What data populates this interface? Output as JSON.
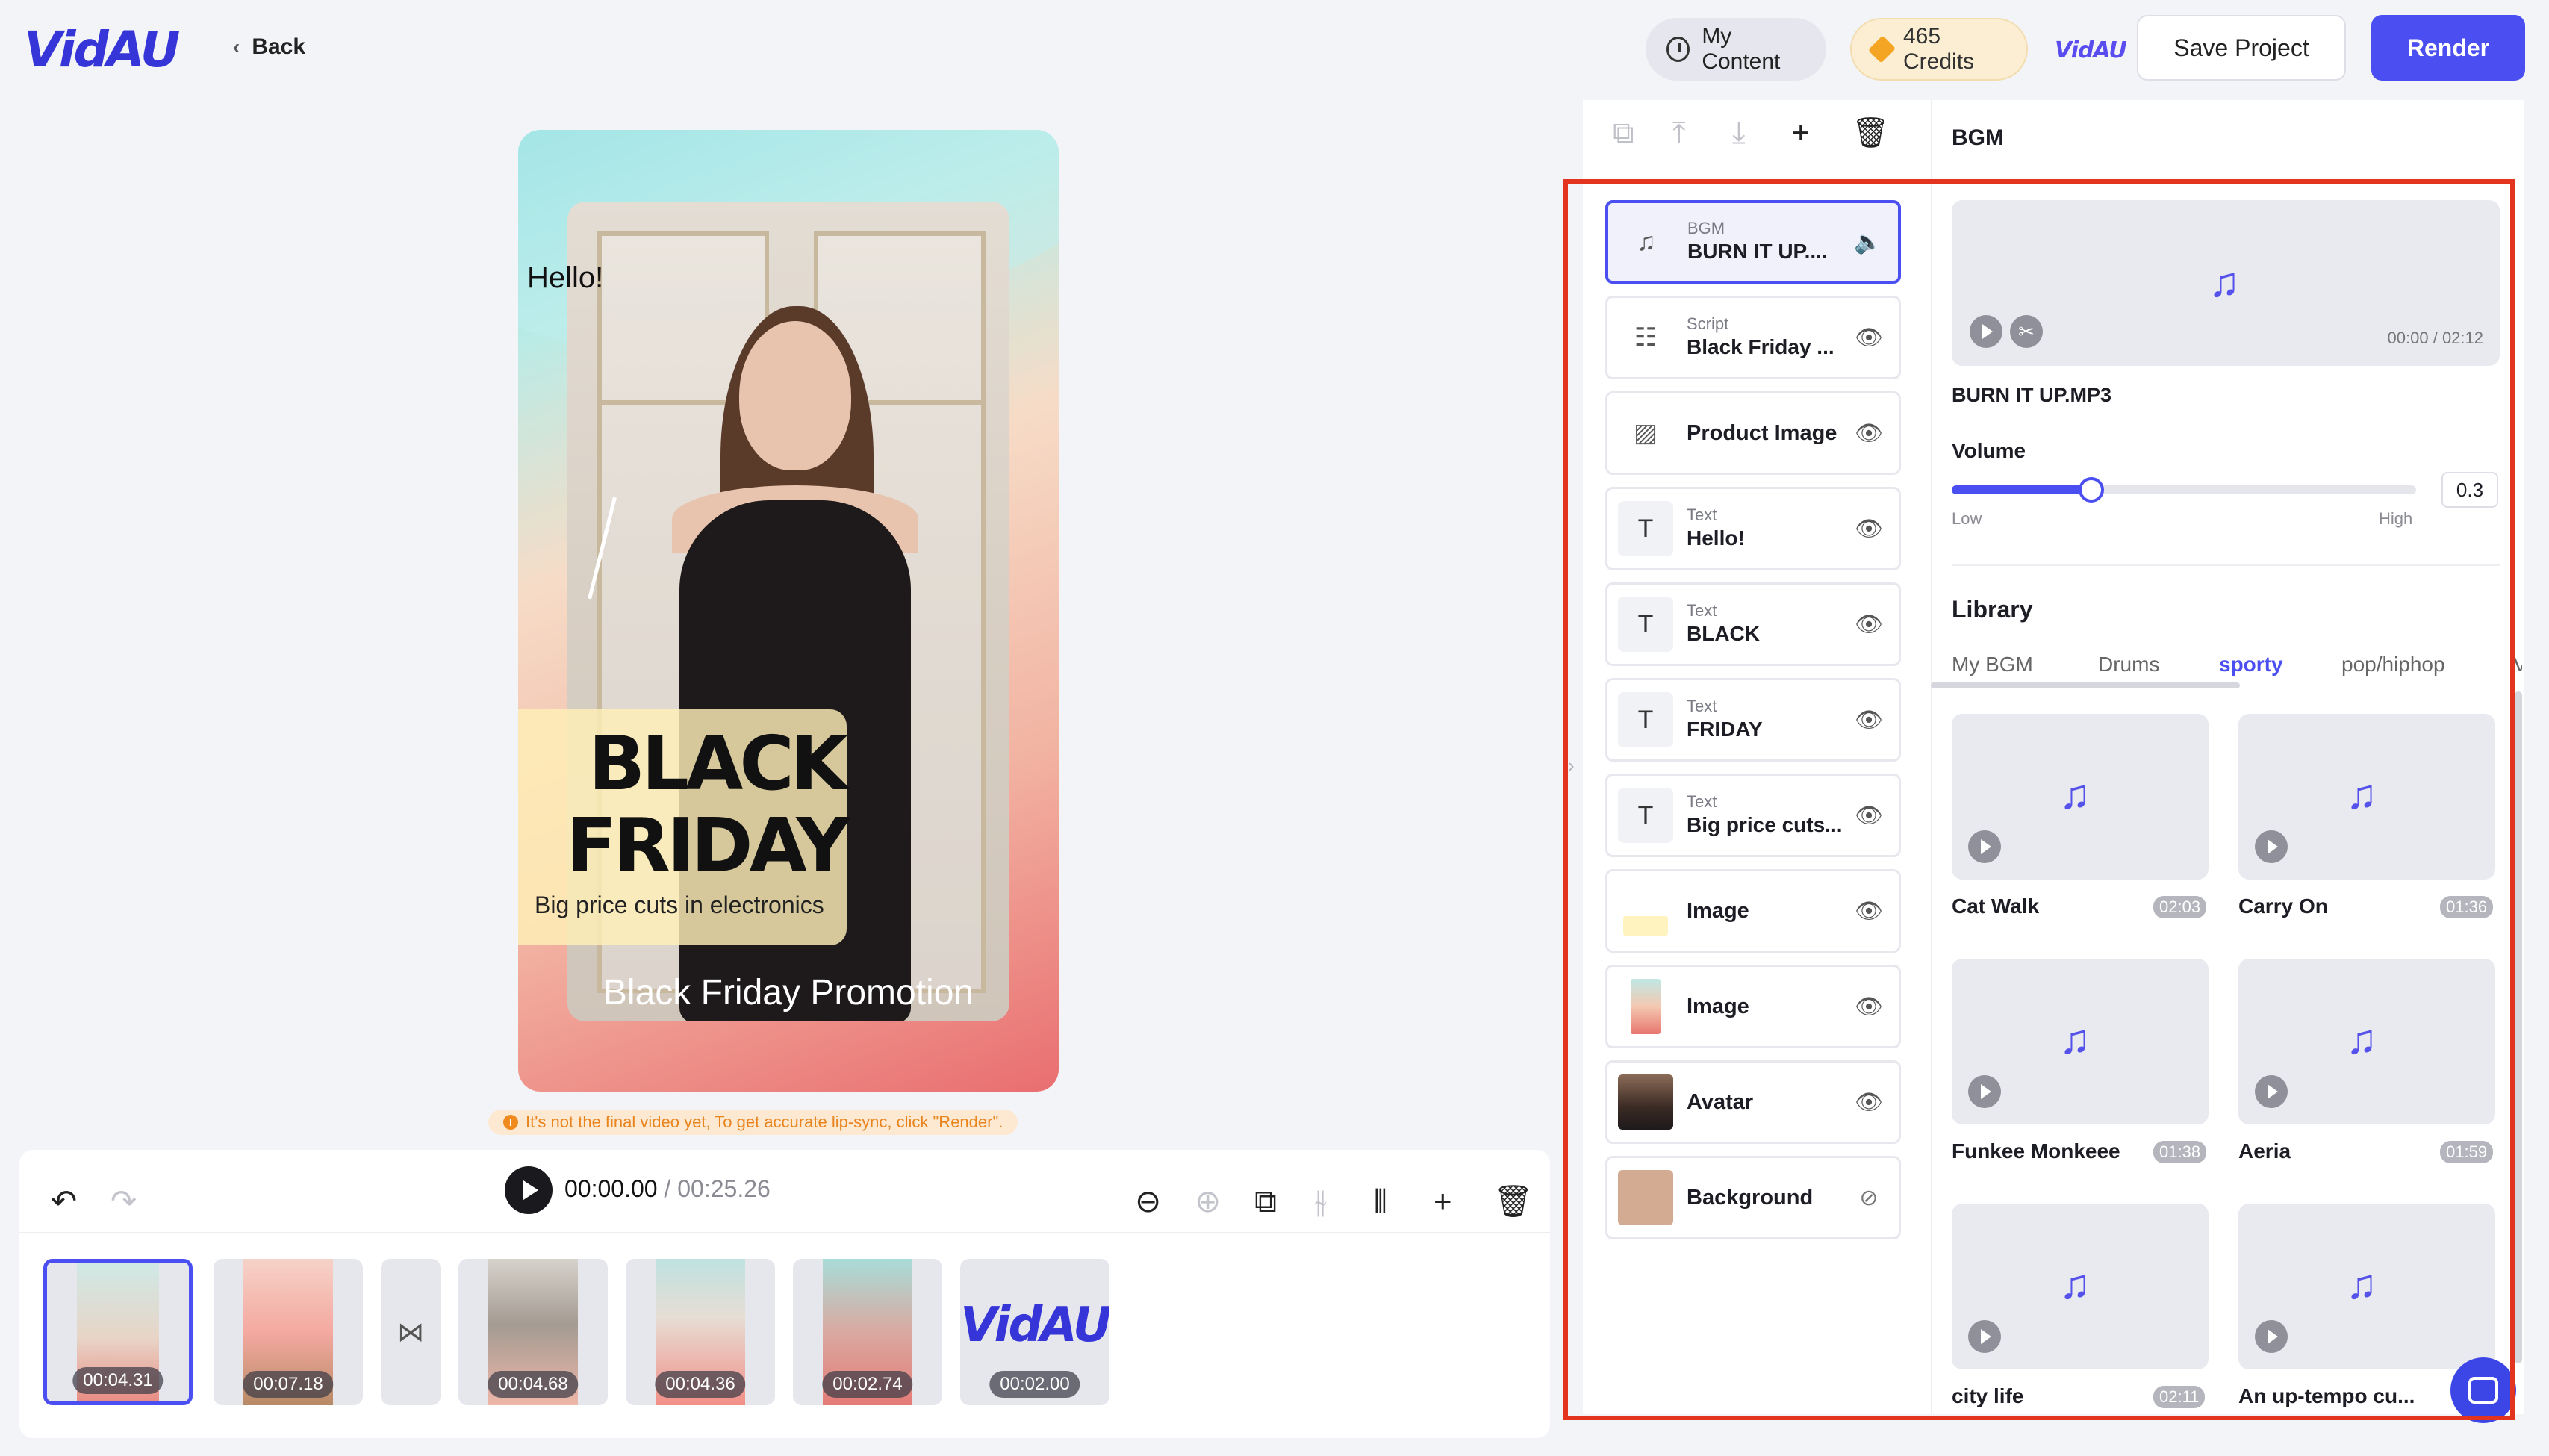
{
  "header": {
    "logo": "VidAU",
    "back_label": "Back",
    "my_content_label": "My Content",
    "credits_label": "465 Credits",
    "mini_logo": "VidAU",
    "save_label": "Save Project",
    "render_label": "Render"
  },
  "preview": {
    "hello_text": "Hello!",
    "black_text": "BLACK",
    "friday_text": "FRIDAY",
    "subtitle": "Big price cuts in electronics",
    "promo_text": "Black Friday Promotion",
    "notice": "It's not the final video yet, To get accurate lip-sync, click \"Render\"."
  },
  "timeline": {
    "current_time": "00:00.00",
    "separator": " / ",
    "total_time": "00:25.26",
    "clips": [
      {
        "duration": "00:04.31",
        "selected": true
      },
      {
        "duration": "00:07.18",
        "selected": false
      },
      {
        "duration": "00:04.68",
        "selected": false
      },
      {
        "duration": "00:04.36",
        "selected": false
      },
      {
        "duration": "00:02.74",
        "selected": false
      },
      {
        "duration": "00:02.00",
        "selected": false,
        "logo": "VidAU"
      }
    ],
    "transition_icon": "bowtie-icon"
  },
  "layers": [
    {
      "kind": "BGM",
      "value": "BURN IT UP....",
      "icon": "music-note-icon",
      "state_icon": "speaker-icon",
      "selected": true
    },
    {
      "kind": "Script",
      "value": "Black Friday ...",
      "icon": "sliders-icon",
      "state_icon": "eye-icon"
    },
    {
      "kind": "",
      "value": "Product Image",
      "icon": "image-icon",
      "state_icon": "eye-icon"
    },
    {
      "kind": "Text",
      "value": "Hello!",
      "icon": "T",
      "state_icon": "eye-icon"
    },
    {
      "kind": "Text",
      "value": "BLACK",
      "icon": "T",
      "state_icon": "eye-icon"
    },
    {
      "kind": "Text",
      "value": "FRIDAY",
      "icon": "T",
      "state_icon": "eye-icon"
    },
    {
      "kind": "Text",
      "value": "Big price cuts...",
      "icon": "T",
      "state_icon": "eye-icon"
    },
    {
      "kind": "",
      "value": "Image",
      "icon": "yellow-swatch",
      "state_icon": "eye-icon"
    },
    {
      "kind": "",
      "value": "Image",
      "icon": "gradient-swatch",
      "state_icon": "eye-icon"
    },
    {
      "kind": "",
      "value": "Avatar",
      "icon": "avatar-thumb",
      "state_icon": "eye-icon"
    },
    {
      "kind": "",
      "value": "Background",
      "icon": "beige-swatch",
      "state_icon": "eye-off-icon"
    }
  ],
  "bgm": {
    "title": "BGM",
    "player_time": "00:00 / 02:12",
    "filename": "BURN IT UP.MP3",
    "volume_label": "Volume",
    "volume_value": "0.3",
    "volume_fraction": 0.3,
    "low_label": "Low",
    "high_label": "High"
  },
  "library": {
    "title": "Library",
    "tabs": [
      "My BGM",
      "Drums",
      "sporty",
      "pop/hiphop",
      "V"
    ],
    "active_tab": "sporty",
    "tracks": [
      {
        "name": "Cat Walk",
        "duration": "02:03"
      },
      {
        "name": "Carry On",
        "duration": "01:36"
      },
      {
        "name": "Funkee Monkeee",
        "duration": "01:38"
      },
      {
        "name": "Aeria",
        "duration": "01:59"
      },
      {
        "name": "city life",
        "duration": "02:11"
      },
      {
        "name": "An up-tempo cu...",
        "duration": ""
      }
    ]
  },
  "colors": {
    "accent": "#4b4ef0",
    "highlight": "#e2341f",
    "notice": "#e9841d"
  }
}
